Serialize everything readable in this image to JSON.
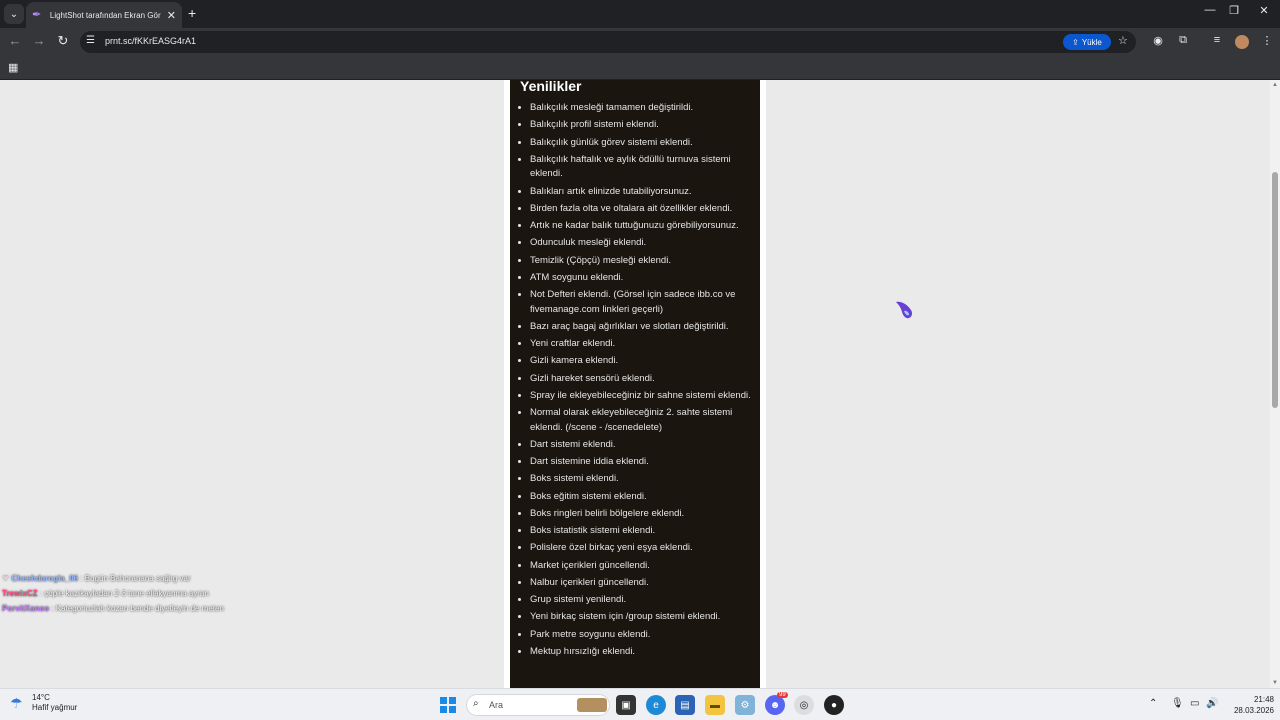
{
  "browser": {
    "tab_title": "LightShot tarafından Ekran Görüntüsü",
    "url": "prnt.sc/fKKrEASG4rA1",
    "upload_label": "Yükle",
    "icons": [
      "tab-search-icon",
      "new-tab-icon",
      "minimize-icon",
      "maximize-icon",
      "close-window-icon",
      "back-icon",
      "forward-icon",
      "reload-icon",
      "site-settings-icon",
      "star-icon",
      "extension-icon",
      "puzzle-icon",
      "reading-list-icon",
      "menu-icon",
      "apps-icon"
    ]
  },
  "page": {
    "heading": "Yenilikler",
    "items": [
      "Balıkçılık mesleği tamamen değiştirildi.",
      "Balıkçılık profil sistemi eklendi.",
      "Balıkçılık günlük görev sistemi eklendi.",
      "Balıkçılık haftalık ve aylık ödüllü turnuva sistemi eklendi.",
      "Balıkları artık elinizde tutabiliyorsunuz.",
      "Birden fazla olta ve oltalara ait özellikler eklendi.",
      "Artık ne kadar balık tuttuğunuzu görebiliyorsunuz.",
      "Odunculuk mesleği eklendi.",
      "Temizlik (Çöpçü) mesleği eklendi.",
      "ATM soygunu eklendi.",
      "Not Defteri eklendi. (Görsel için sadece ibb.co ve fivemanage.com linkleri geçerli)",
      "Bazı araç bagaj ağırlıkları ve slotları değiştirildi.",
      "Yeni craftlar eklendi.",
      "Gizli kamera eklendi.",
      "Gizli hareket sensörü eklendi.",
      "Spray ile ekleyebileceğiniz bir sahne sistemi eklendi.",
      "Normal olarak ekleyebileceğiniz 2. sahte sistemi eklendi. (/scene - /scenedelete)",
      "Dart sistemi eklendi.",
      "Dart sistemine iddia eklendi.",
      "Boks sistemi eklendi.",
      "Boks eğitim sistemi eklendi.",
      "Boks ringleri belirli bölgelere eklendi.",
      "Boks istatistik sistemi eklendi.",
      "Polislere özel birkaç yeni eşya eklendi.",
      "Market içerikleri güncellendi.",
      "Nalbur içerikleri güncellendi.",
      "Grup sistemi yenilendi.",
      "Yeni birkaç sistem için /group sistemi eklendi.",
      "Park metre soygunu eklendi.",
      "Mektup hırsızlığı eklendi."
    ]
  },
  "chat": [
    {
      "user": "Cheshdarogla_06",
      "text": ": Bugün Bahoranana sağlıg var"
    },
    {
      "user": "TrewixCZ",
      "text": ": çöple kazıkayladan 2-3 tane ellakyanma ayran"
    },
    {
      "user": "PorvitXanoo",
      "text": ": Kategoriuzlah kozan bende diyetleyin de meten"
    }
  ],
  "taskbar": {
    "temperature": "14°C",
    "weather": "Hafif yağmur",
    "search_placeholder": "Ara",
    "time": "21:48",
    "date": "28.03.2026",
    "badge_discord": "99"
  }
}
